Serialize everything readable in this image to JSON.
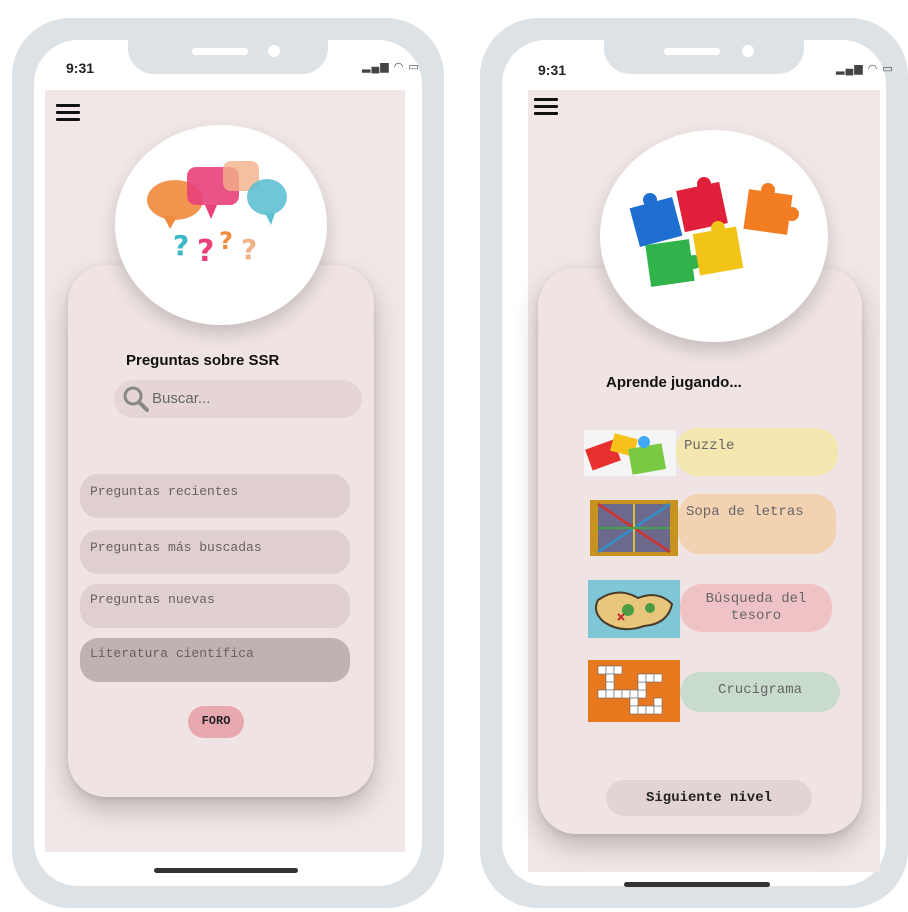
{
  "left_phone": {
    "time": "9:31",
    "status_icons": "signal-wifi-battery-icons",
    "menu_icon": "hamburger-menu-icon",
    "hero_image": "speech-bubbles-question-marks-image",
    "title": "Preguntas sobre SSR",
    "search": {
      "placeholder": "Buscar...",
      "icon": "search-icon"
    },
    "menu_items": [
      {
        "label": "Preguntas recientes"
      },
      {
        "label": "Preguntas más buscadas"
      },
      {
        "label": "Preguntas nuevas"
      },
      {
        "label": "Literatura científica"
      }
    ],
    "foro_button": "FORO"
  },
  "right_phone": {
    "time": "9:31",
    "status_icons": "signal-wifi-battery-icons",
    "menu_icon": "hamburger-menu-icon",
    "hero_image": "colorful-puzzle-pieces-image",
    "title": "Aprende jugando...",
    "games": [
      {
        "label": "Puzzle",
        "color": "#f3e6ae",
        "thumb": "puzzle-thumb"
      },
      {
        "label": "Sopa de letras",
        "color": "#f3d2b2",
        "thumb": "word-search-thumb"
      },
      {
        "label": "Búsqueda del tesoro",
        "color": "#efc3c6",
        "thumb": "treasure-map-thumb"
      },
      {
        "label": "Crucigrama",
        "color": "#c9dccc",
        "thumb": "crossword-thumb"
      }
    ],
    "next_button": "Siguiente nivel"
  }
}
